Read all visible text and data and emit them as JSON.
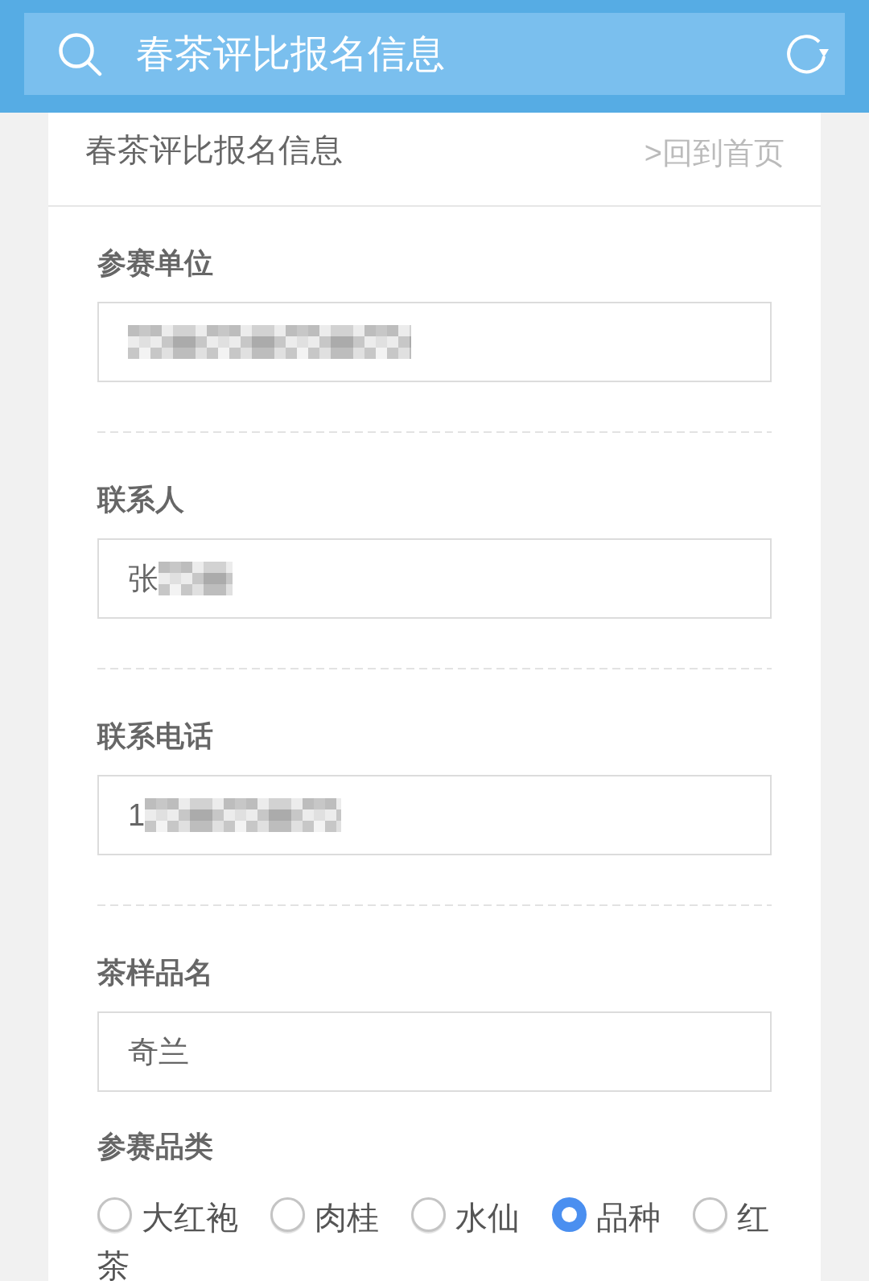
{
  "header": {
    "title": "春茶评比报名信息"
  },
  "page": {
    "title": "春茶评比报名信息",
    "home_link": ">回到首页"
  },
  "fields": [
    {
      "label": "参赛单位",
      "redacted": true
    },
    {
      "label": "联系人",
      "value": "张",
      "redacted": true
    },
    {
      "label": "联系电话",
      "value": "1",
      "redacted": true
    },
    {
      "label": "茶样品名",
      "value": "奇兰",
      "redacted": false
    }
  ],
  "category": {
    "label": "参赛品类",
    "options": [
      {
        "label": "大红袍",
        "selected": false
      },
      {
        "label": "肉桂",
        "selected": false
      },
      {
        "label": "水仙",
        "selected": false
      },
      {
        "label": "品种",
        "selected": true
      },
      {
        "label": "红",
        "label_wrapped": "茶",
        "selected": false
      }
    ]
  }
}
